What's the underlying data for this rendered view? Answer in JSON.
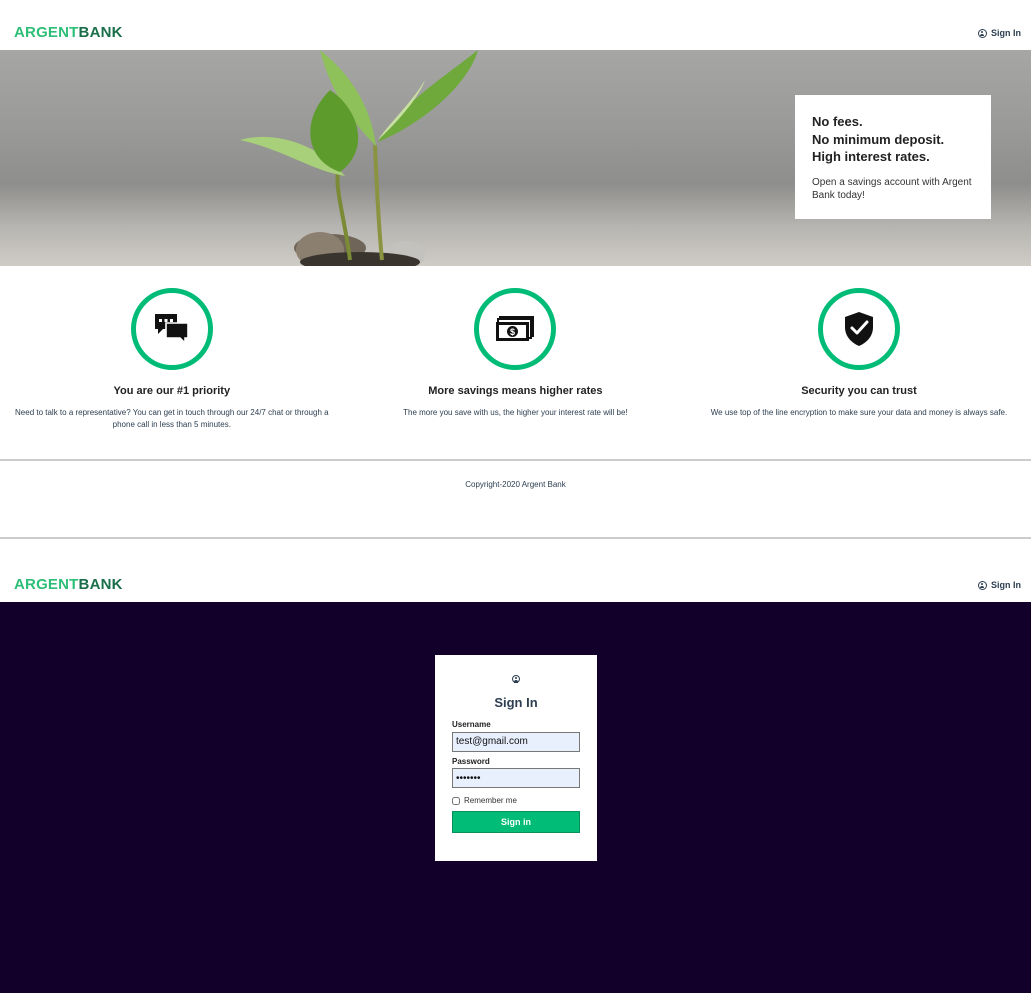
{
  "top_nav": {
    "logo_part1": "ARGENT",
    "logo_part2": "BANK",
    "signin_label": "Sign In"
  },
  "hero": {
    "subtitles": [
      "No fees.",
      "No minimum deposit.",
      "High interest rates."
    ],
    "text": "Open a savings account with Argent Bank today!"
  },
  "features": [
    {
      "icon": "chat-icon",
      "title": "You are our #1 priority",
      "text": "Need to talk to a representative? You can get in touch through our 24/7 chat or through a phone call in less than 5 minutes."
    },
    {
      "icon": "money-icon",
      "title": "More savings means higher rates",
      "text": "The more you save with us, the higher your interest rate will be!"
    },
    {
      "icon": "security-icon",
      "title": "Security you can trust",
      "text": "We use top of the line encryption to make sure your data and money is always safe."
    }
  ],
  "footer": {
    "copyright": "Copyright-2020 Argent Bank"
  },
  "bottom_nav": {
    "logo_part1": "ARGENT",
    "logo_part2": "BANK",
    "signin_label": "Sign In"
  },
  "login": {
    "title": "Sign In",
    "username_label": "Username",
    "username_value": "test@gmail.com",
    "password_label": "Password",
    "password_value": "•••••••",
    "remember_label": "Remember me",
    "remember_checked": false,
    "button_label": "Sign in"
  },
  "colors": {
    "accent": "#00bc77",
    "logo_dark": "#1a6e4a",
    "login_background": "#12002b"
  }
}
